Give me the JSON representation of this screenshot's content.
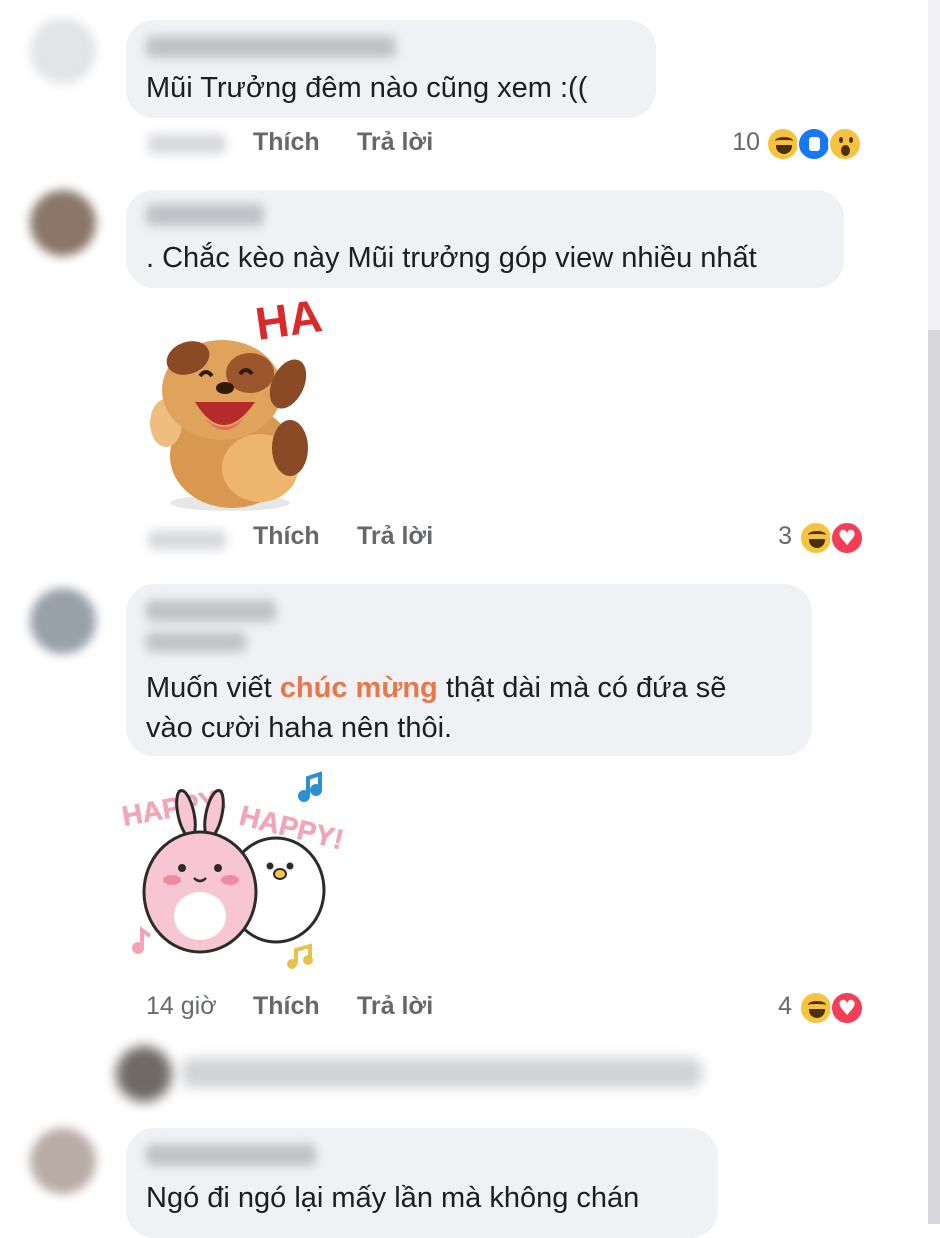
{
  "actions": {
    "like": "Thích",
    "reply": "Trả lời"
  },
  "comments": [
    {
      "text": "Mũi Trưởng đêm nào cũng xem :((",
      "reaction_count": "10",
      "reactions": [
        "haha-icon",
        "like-icon",
        "wow-icon"
      ]
    },
    {
      "text": ". Chắc kèo này Mũi trưởng góp view nhiều nhất",
      "sticker": {
        "text": "HA"
      },
      "reaction_count": "3",
      "reactions": [
        "haha-icon",
        "love-icon"
      ]
    },
    {
      "text_before": "Muốn viết ",
      "text_highlight": "chúc mừng",
      "text_after": " thật dài mà có đứa sẽ",
      "text_line2": "vào cười haha nên thôi.",
      "sticker": {
        "text_left": "HAPPY!",
        "text_right": "HAPPY!"
      },
      "time": "14 giờ",
      "reaction_count": "4",
      "reactions": [
        "haha-icon",
        "love-icon"
      ]
    },
    {
      "text": "Ngó đi ngó lại mấy lần mà không chán"
    }
  ],
  "colors": {
    "bubble": "#eff1f4",
    "highlight": "#e8784a",
    "action": "#65676b",
    "like": "#1877f2",
    "love": "#f33e58",
    "haha": "#f7c23d"
  }
}
